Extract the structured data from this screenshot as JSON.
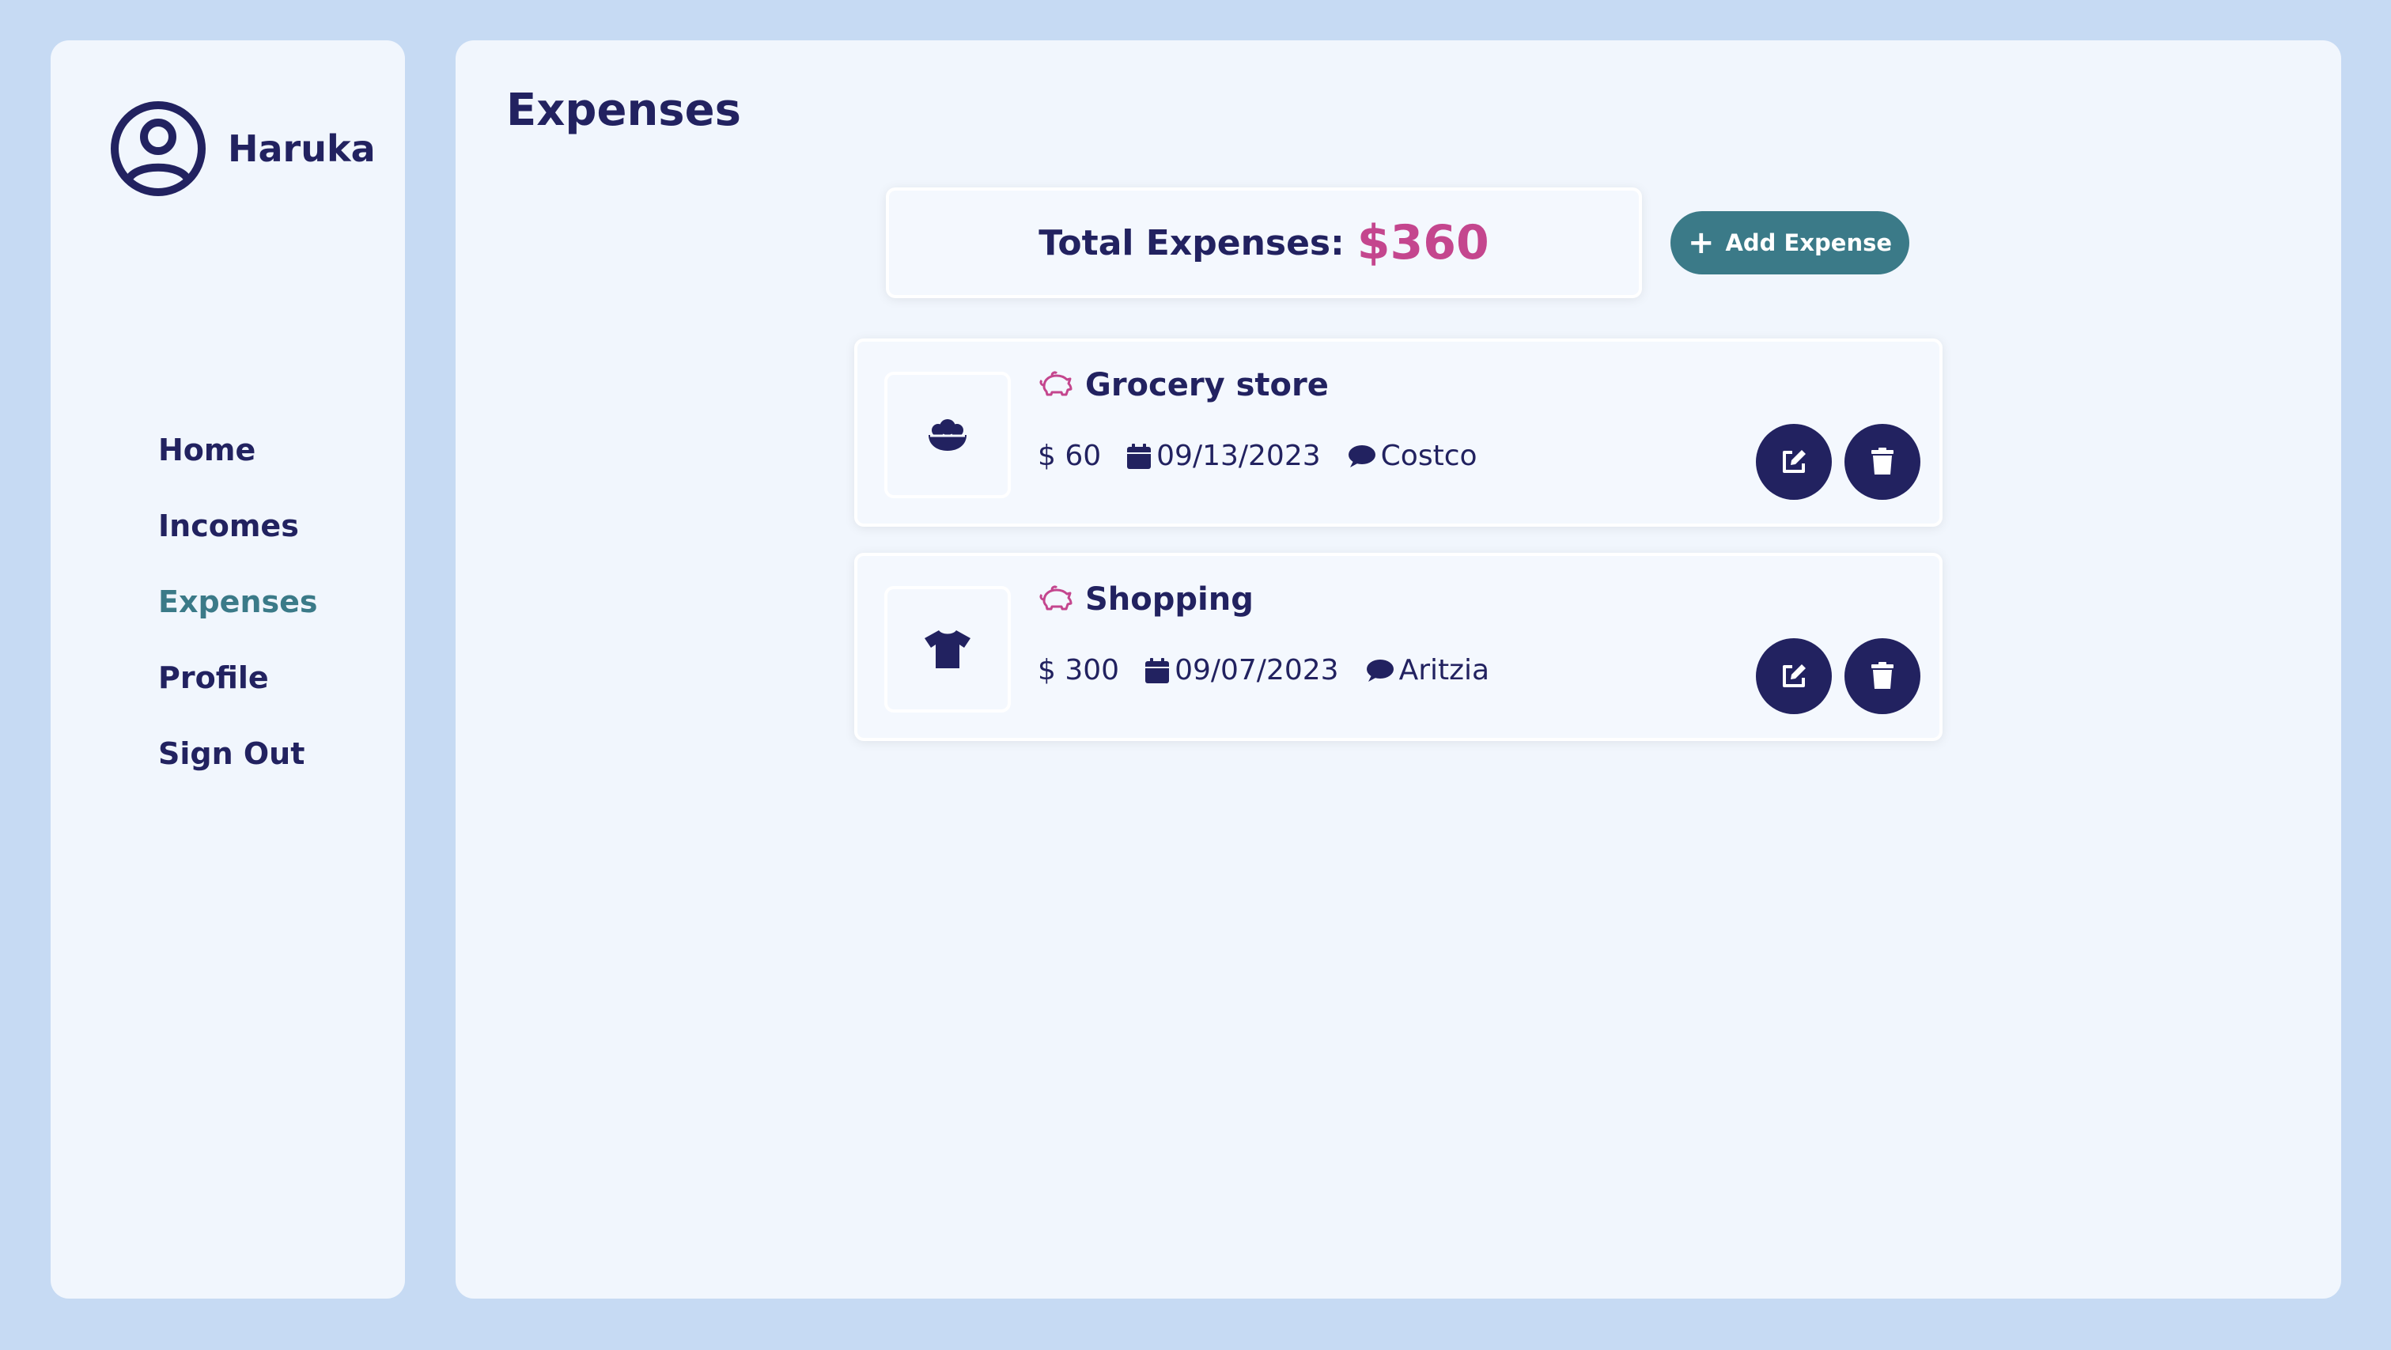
{
  "sidebar": {
    "user_name": "Haruka",
    "nav": [
      {
        "label": "Home"
      },
      {
        "label": "Incomes"
      },
      {
        "label": "Expenses"
      },
      {
        "label": "Profile"
      },
      {
        "label": "Sign Out"
      }
    ]
  },
  "main": {
    "title": "Expenses",
    "total_label": "Total Expenses:",
    "total_value": "$360",
    "add_button_label": "Add Expense",
    "expenses": [
      {
        "title": "Grocery store",
        "amount": "$ 60",
        "date": "09/13/2023",
        "note": "Costco",
        "category_icon": "bowl-food-icon"
      },
      {
        "title": "Shopping",
        "amount": "$ 300",
        "date": "09/07/2023",
        "note": "Aritzia",
        "category_icon": "tshirt-icon"
      }
    ]
  },
  "colors": {
    "background": "#c6daf3",
    "panel": "#f1f6fd",
    "text": "#222260",
    "accent": "#3b7a88",
    "total": "#c4468e"
  }
}
